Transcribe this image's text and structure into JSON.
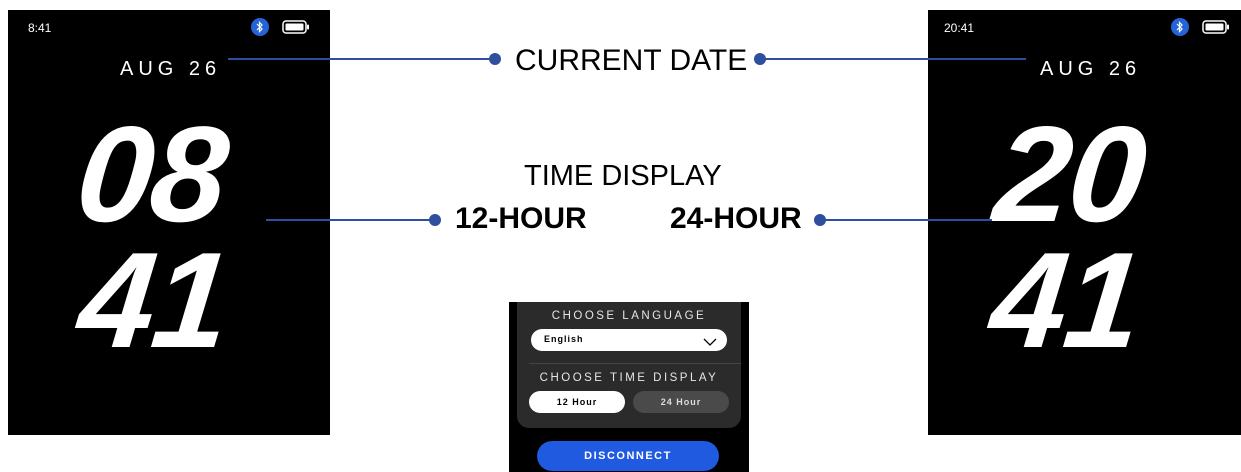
{
  "left_screen": {
    "status_time": "8:41",
    "date": "AUG 26",
    "hour": "08",
    "minute": "41"
  },
  "right_screen": {
    "status_time": "20:41",
    "date": "AUG 26",
    "hour": "20",
    "minute": "41"
  },
  "callouts": {
    "current_date": "CURRENT DATE",
    "time_display": "TIME DISPLAY",
    "twelve_hour": "12-HOUR",
    "twenty_four_hour": "24-HOUR"
  },
  "settings_panel": {
    "language_heading": "CHOOSE LANGUAGE",
    "language_value": "English",
    "time_display_heading": "CHOOSE TIME DISPLAY",
    "time_options": [
      "12 Hour",
      "24 Hour"
    ],
    "selected_time_option": "12 Hour",
    "disconnect_label": "DISCONNECT"
  },
  "icons": {
    "bluetooth": "bluetooth-icon",
    "battery": "battery-icon",
    "chevron": "chevron-down-icon"
  },
  "colors": {
    "accent_blue": "#1f5ae0",
    "callout_line": "#2e4f9e",
    "bluetooth_blue": "#2563d8"
  }
}
